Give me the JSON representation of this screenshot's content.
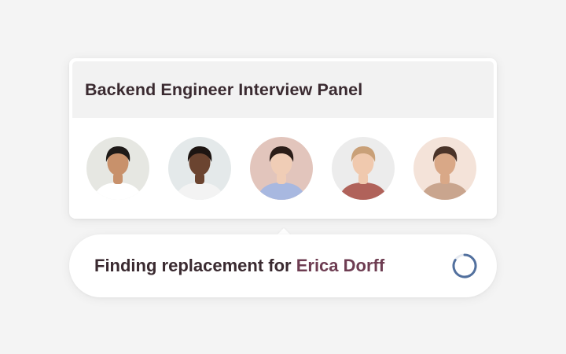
{
  "panel": {
    "title": "Backend Engineer Interview Panel",
    "avatars": [
      {
        "icon": "person-avatar",
        "bg": "#e6e7e2",
        "skin": "#c8916b",
        "hair": "#1e1a18",
        "shirt": "#ffffff"
      },
      {
        "icon": "person-avatar",
        "bg": "#e4e9ea",
        "skin": "#6b4430",
        "hair": "#1d1512",
        "shirt": "#f3f3f3"
      },
      {
        "icon": "person-avatar",
        "bg": "#e2c5bc",
        "skin": "#f0cdb6",
        "hair": "#2b1d18",
        "shirt": "#a8b8e0"
      },
      {
        "icon": "person-avatar",
        "bg": "#ececec",
        "skin": "#f0c9ae",
        "hair": "#c9a078",
        "shirt": "#b0625a"
      },
      {
        "icon": "person-avatar",
        "bg": "#f4e3d9",
        "skin": "#d9a887",
        "hair": "#4a3328",
        "shirt": "#c9a58e"
      }
    ]
  },
  "status": {
    "prefix": "Finding replacement for ",
    "name": "Erica Dorff",
    "spinner_icon": "loading-spinner-icon",
    "spinner_color": "#52709e"
  },
  "colors": {
    "background": "#f4f4f4",
    "text": "#3a2a30",
    "accent_name": "#6e3d52"
  }
}
